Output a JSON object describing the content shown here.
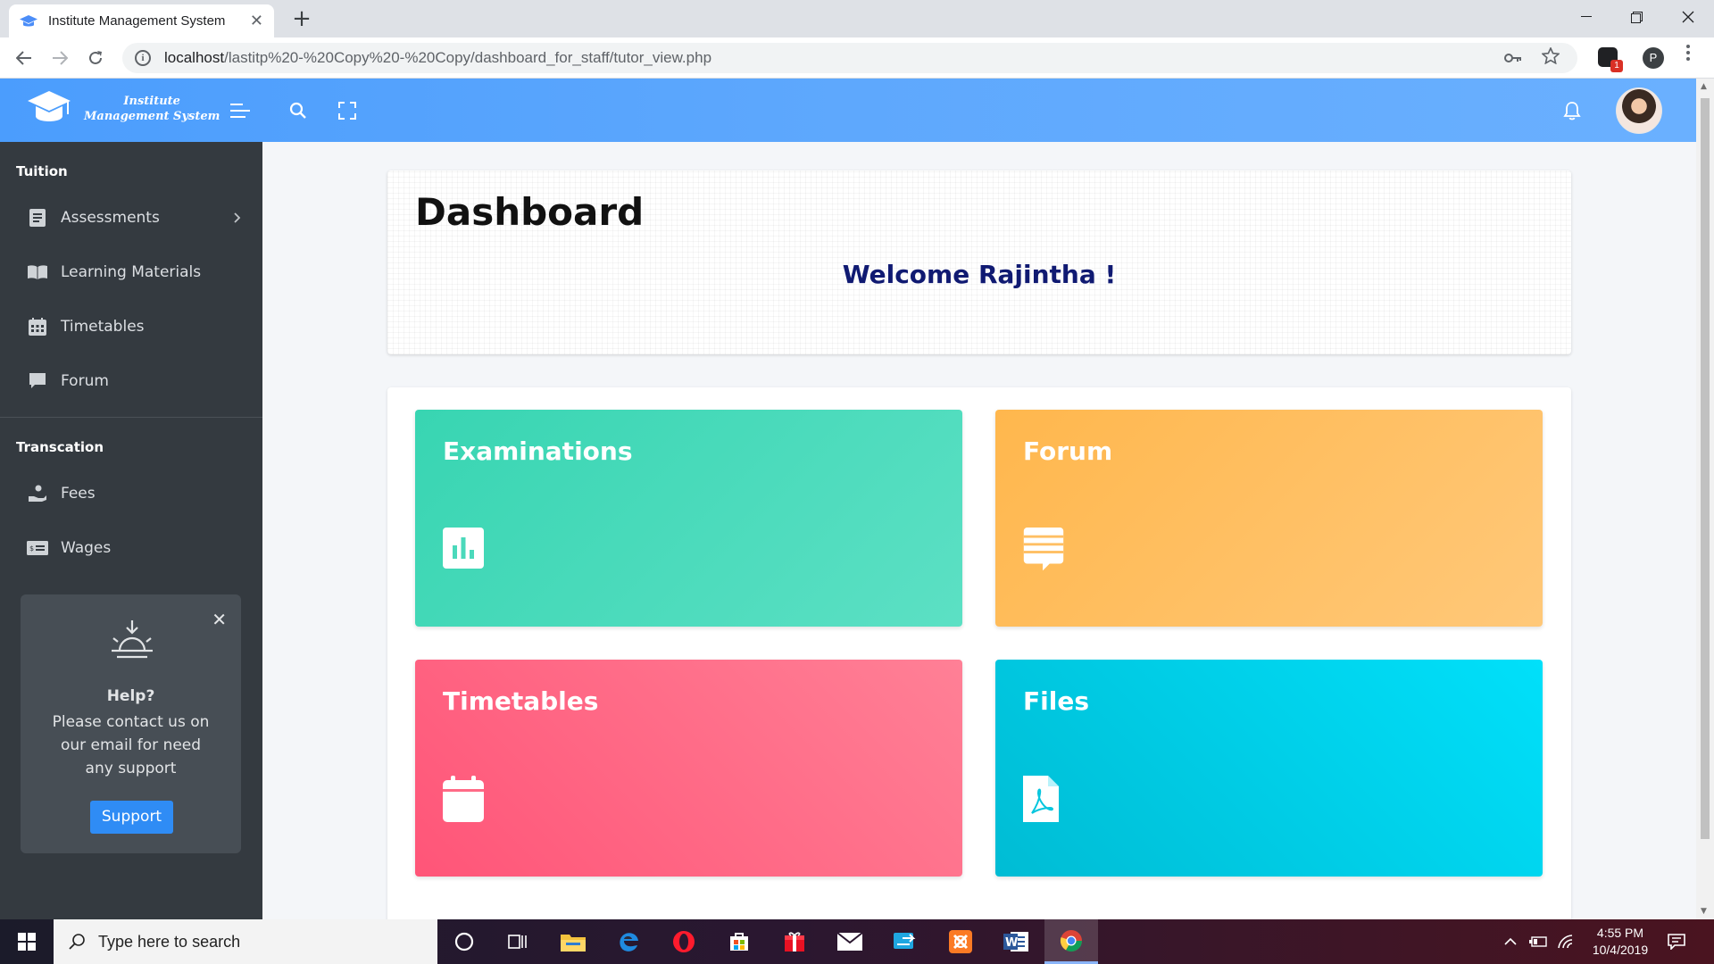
{
  "browser": {
    "tab_title": "Institute Management System",
    "tab_close": "✕",
    "new_tab": "+",
    "url_host": "localhost",
    "url_path": "/lastitp%20-%20Copy%20-%20Copy/dashboard_for_staff/tutor_view.php",
    "profile_initial": "P",
    "extension_badge": "1"
  },
  "header": {
    "logo_line1": "Institute",
    "logo_line2": "Management System"
  },
  "sidebar": {
    "section1": "Tuition",
    "items1": [
      {
        "label": "Assessments",
        "icon": "file-icon"
      },
      {
        "label": "Learning Materials",
        "icon": "book-icon"
      },
      {
        "label": "Timetables",
        "icon": "calendar-icon"
      },
      {
        "label": "Forum",
        "icon": "comment-icon"
      }
    ],
    "section2": "Transcation",
    "items2": [
      {
        "label": "Fees",
        "icon": "hand-coin-icon"
      },
      {
        "label": "Wages",
        "icon": "money-bill-icon"
      }
    ],
    "help": {
      "title": "Help?",
      "text": "Please contact us on our email for need any support",
      "button": "Support",
      "close": "✕"
    }
  },
  "main": {
    "title": "Dashboard",
    "welcome": "Welcome Rajintha !",
    "tiles": [
      {
        "label": "Examinations",
        "icon": "bar-chart-icon",
        "color": "#38d5b2"
      },
      {
        "label": "Forum",
        "icon": "message-icon",
        "color": "#ffb74d"
      },
      {
        "label": "Timetables",
        "icon": "calendar-icon",
        "color": "#ff5578"
      },
      {
        "label": "Files",
        "icon": "pdf-file-icon",
        "color": "#00bcd4"
      }
    ]
  },
  "taskbar": {
    "search_placeholder": "Type here to search",
    "time": "4:55 PM",
    "date": "10/4/2019"
  },
  "colors": {
    "header": "#4b9dfd",
    "sidebar": "#343a40",
    "welcome": "#101a72",
    "support_button": "#2f8cf5"
  }
}
